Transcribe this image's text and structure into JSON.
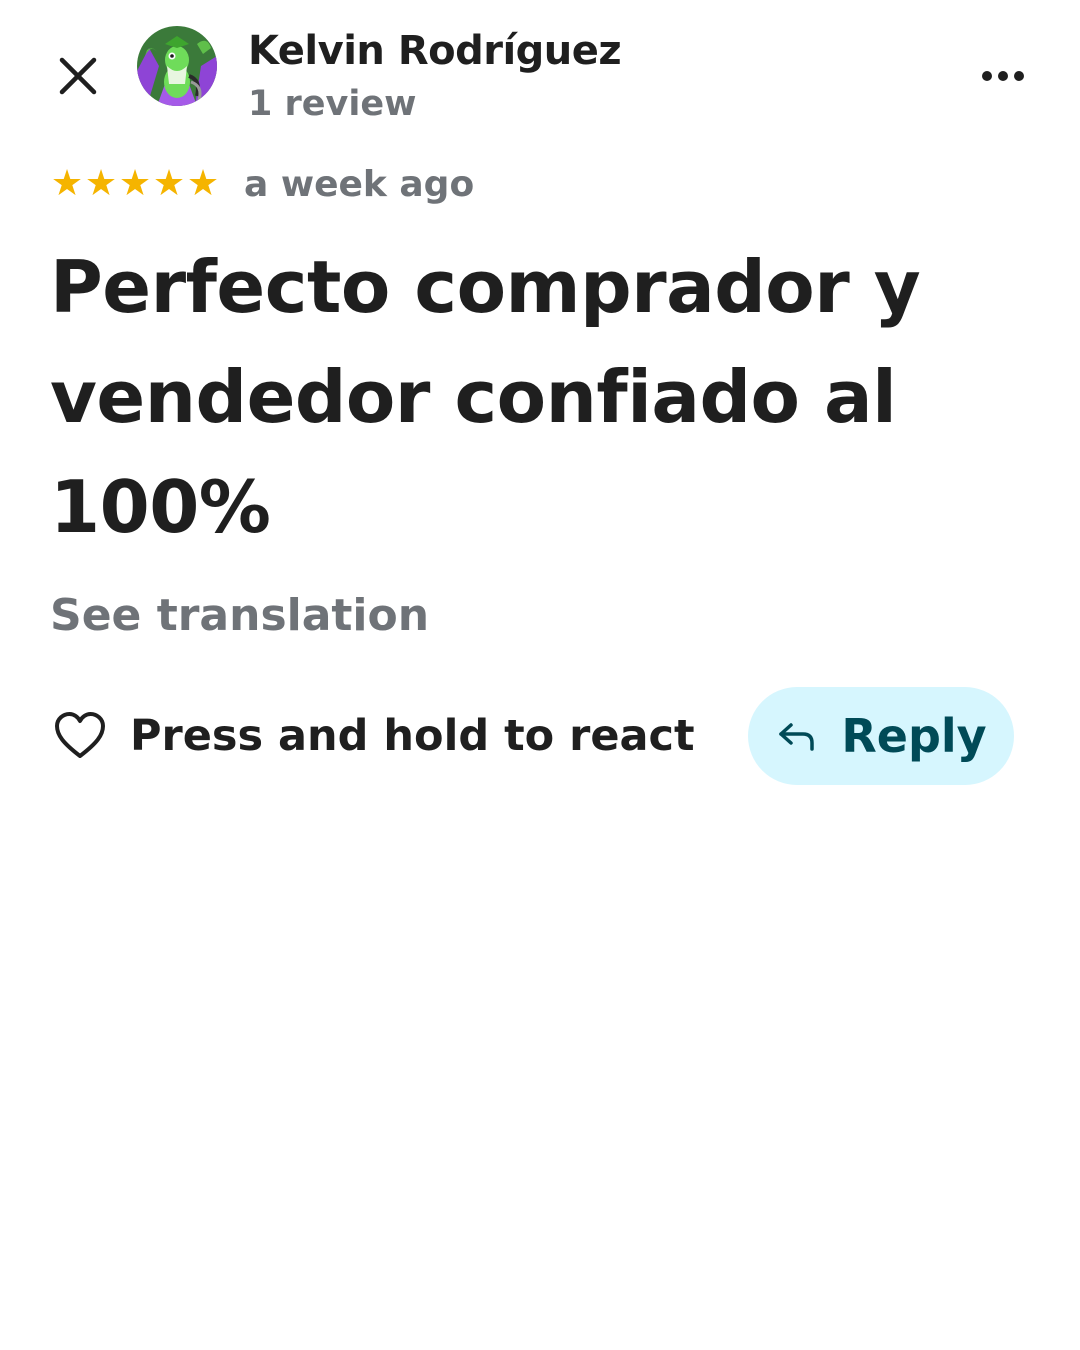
{
  "header": {
    "author_name": "Kelvin Rodríguez",
    "review_count": "1 review",
    "close_icon": "close-icon",
    "more_icon": "more-horizontal-icon"
  },
  "review": {
    "rating": 5,
    "rating_max": 5,
    "star_color": "#f5b400",
    "time_ago": "a week ago",
    "text": "Perfecto comprador y vendedor confiado al 100%",
    "see_translation": "See translation"
  },
  "actions": {
    "react_label": "Press and hold to react",
    "react_icon": "heart-outline-icon",
    "reply_label": "Reply",
    "reply_icon": "reply-arrow-icon",
    "reply_bg_color": "#d6f6fe",
    "reply_text_color": "#004a57"
  }
}
